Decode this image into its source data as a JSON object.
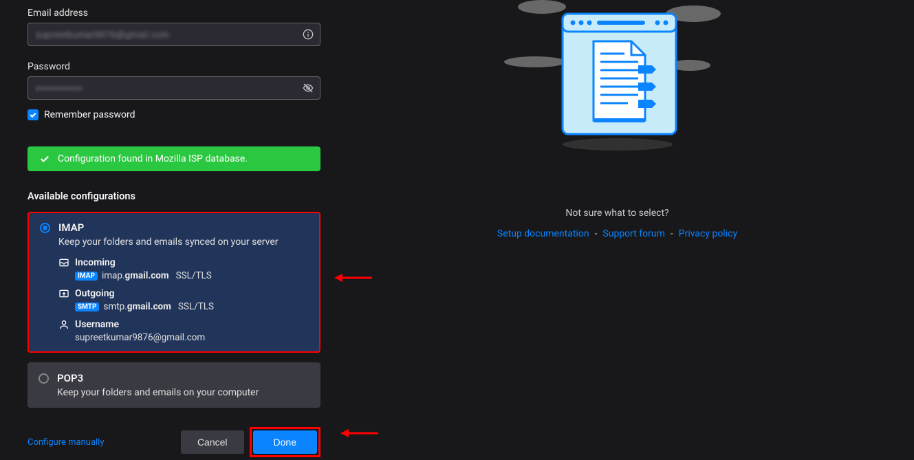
{
  "form": {
    "email_label": "Email address",
    "email_value": "supreetkumar9876@gmail.com",
    "password_label": "Password",
    "password_value": "••••••••••••••",
    "remember_label": "Remember password"
  },
  "banner": {
    "message": "Configuration found in Mozilla ISP database."
  },
  "configs": {
    "title": "Available configurations",
    "imap": {
      "title": "IMAP",
      "desc": "Keep your folders and emails synced on your server",
      "incoming_label": "Incoming",
      "incoming_proto": "IMAP",
      "incoming_server_prefix": "imap.",
      "incoming_server_bold": "gmail.com",
      "incoming_ssl": "SSL/TLS",
      "outgoing_label": "Outgoing",
      "outgoing_proto": "SMTP",
      "outgoing_server_prefix": "smtp.",
      "outgoing_server_bold": "gmail.com",
      "outgoing_ssl": "SSL/TLS",
      "username_label": "Username",
      "username_value": "supreetkumar9876@gmail.com"
    },
    "pop3": {
      "title": "POP3",
      "desc": "Keep your folders and emails on your computer"
    }
  },
  "actions": {
    "configure_manually": "Configure manually",
    "cancel": "Cancel",
    "done": "Done"
  },
  "right": {
    "prompt": "Not sure what to select?",
    "link1": "Setup documentation",
    "link2": "Support forum",
    "link3": "Privacy policy",
    "sep": "-"
  }
}
